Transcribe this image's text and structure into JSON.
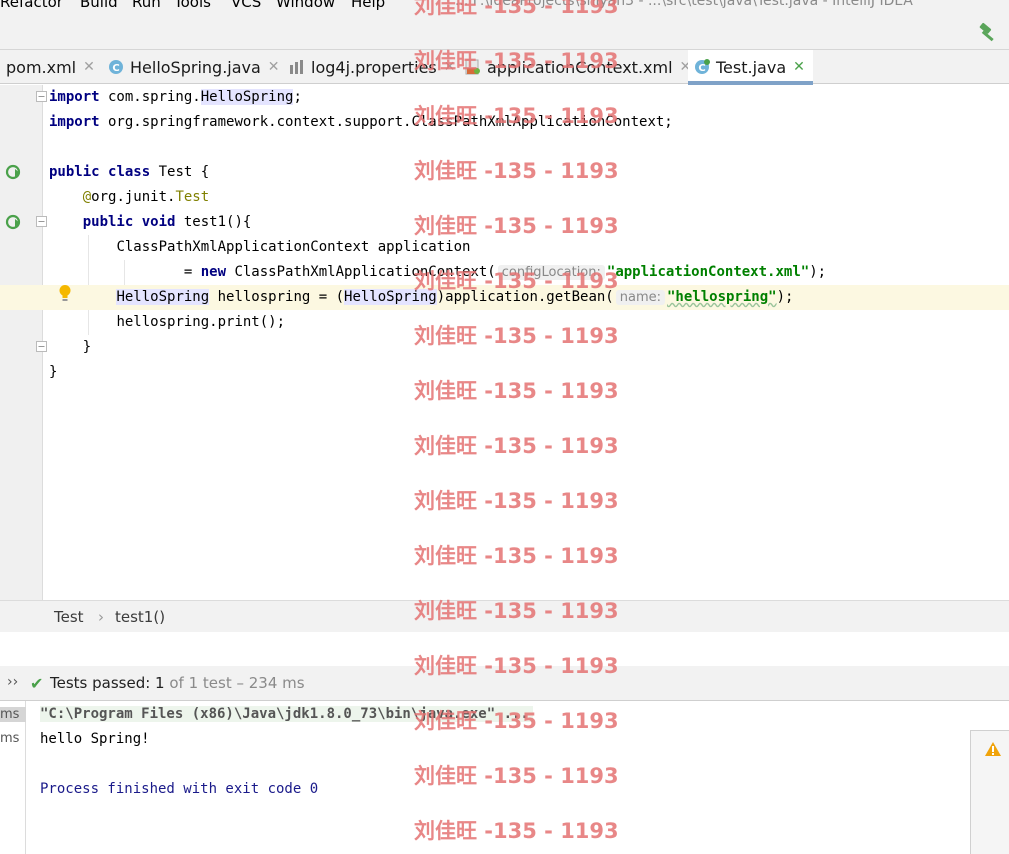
{
  "menu": {
    "items": [
      "Refactor",
      "Build",
      "Run",
      "Tools",
      "VCS",
      "Window",
      "Help"
    ],
    "path_text": "... F:\\IdeaProjects\\shiyan3 - ...\\src\\test\\java\\Test.java - IntelliJ IDEA"
  },
  "tabs": [
    {
      "label": "pom.xml",
      "icon": "maven-file-icon"
    },
    {
      "label": "HelloSpring.java",
      "icon": "class-icon"
    },
    {
      "label": "log4j.properties",
      "icon": "properties-icon"
    },
    {
      "label": "applicationContext.xml",
      "icon": "spring-xml-icon"
    },
    {
      "label": "Test.java",
      "icon": "test-class-icon",
      "active": true
    }
  ],
  "code": {
    "l1_kw": "import",
    "l1_a": " com.spring.",
    "l1_cls": "HelloSpring",
    "l1_b": ";",
    "l2_kw": "import",
    "l2_a": " org.springframework.context.support.ClassPathXmlApplicationContext;",
    "l4_kw1": "public",
    "l4_kw2": "class",
    "l4_a": " Test {",
    "l5_ann": "@",
    "l5_a": "org.junit.",
    "l5_b": "Test",
    "l6_kw1": "public",
    "l6_kw2": "void",
    "l6_a": " test1(){",
    "l7_a": "ClassPathXmlApplicationContext application",
    "l8_a": "= ",
    "l8_kw": "new",
    "l8_b": " ClassPathXmlApplicationContext(",
    "l8_hint": "configLocation:",
    "l8_str": "\"applicationContext.xml\"",
    "l8_c": ");",
    "l9_cls1": "HelloSpring",
    "l9_a": " hellospring = (",
    "l9_cls2": "HelloSpring",
    "l9_b": ")application.getBean(",
    "l9_hint": "name:",
    "l9_str": "\"hellospring\"",
    "l9_c": ");",
    "l10_a": "hellospring.print();",
    "l11_a": "}",
    "l12_a": "}"
  },
  "breadcrumbs": {
    "class": "Test",
    "sep": "›",
    "method": "test1()"
  },
  "tests": {
    "status_prefix": "Tests passed: ",
    "passed": "1",
    "total_text": " of 1 test – 234 ms"
  },
  "console": {
    "gutter": [
      "ms",
      "ms"
    ],
    "command": "\"C:\\Program Files (x86)\\Java\\jdk1.8.0_73\\bin\\java.exe\" ...",
    "output": "hello Spring!",
    "process": "Process finished with exit code 0"
  },
  "watermark": "刘佳旺 -135 - 1193",
  "colors": {
    "accent": "#7fa2c8",
    "keyword": "#000080",
    "string": "#008000",
    "pass": "#4aa14a",
    "watermark": "#e57373"
  }
}
